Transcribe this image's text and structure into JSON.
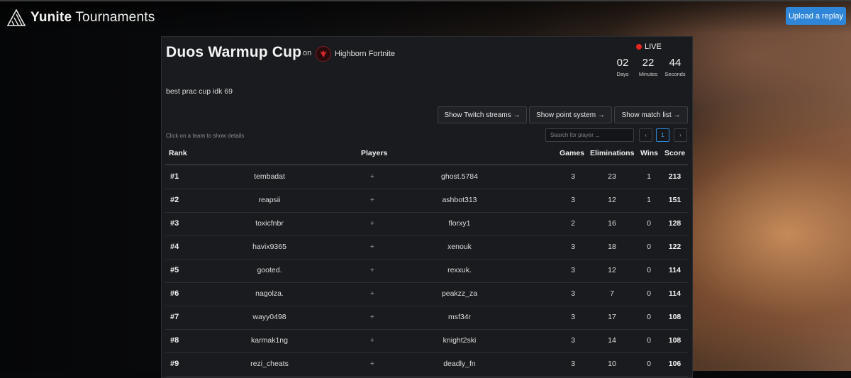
{
  "app": {
    "brand_bold": "Yunite",
    "brand_rest": " Tournaments",
    "upload_label": "Upload a replay"
  },
  "tournament": {
    "title": "Duos Warmup Cup",
    "on_label": "on",
    "org_name": "Highborn Fortnite",
    "description": "best prac cup idk 69",
    "live_label": "LIVE",
    "countdown": [
      {
        "value": "02",
        "label": "Days"
      },
      {
        "value": "22",
        "label": "Minutes"
      },
      {
        "value": "44",
        "label": "Seconds"
      }
    ]
  },
  "actions": [
    {
      "label": "Show Twitch streams →"
    },
    {
      "label": "Show point system →"
    },
    {
      "label": "Show match list →"
    }
  ],
  "hint": "Click on a team to show details",
  "search": {
    "placeholder": "Search for player ..."
  },
  "pagination": {
    "prev": "‹",
    "current": "1",
    "next": "›"
  },
  "table": {
    "headers": {
      "rank": "Rank",
      "players": "Players",
      "games": "Games",
      "eliminations": "Eliminations",
      "wins": "Wins",
      "score": "Score"
    },
    "plus": "+",
    "rows": [
      {
        "rank": "#1",
        "player1": "tembadat",
        "player2": "ghost.5784",
        "games": "3",
        "elims": "23",
        "wins": "1",
        "score": "213"
      },
      {
        "rank": "#2",
        "player1": "reapsii",
        "player2": "ashbot313",
        "games": "3",
        "elims": "12",
        "wins": "1",
        "score": "151"
      },
      {
        "rank": "#3",
        "player1": "toxicfnbr",
        "player2": "florxy1",
        "games": "2",
        "elims": "16",
        "wins": "0",
        "score": "128"
      },
      {
        "rank": "#4",
        "player1": "havix9365",
        "player2": "xenouk",
        "games": "3",
        "elims": "18",
        "wins": "0",
        "score": "122"
      },
      {
        "rank": "#5",
        "player1": "gooted.",
        "player2": "rexxuk.",
        "games": "3",
        "elims": "12",
        "wins": "0",
        "score": "114"
      },
      {
        "rank": "#6",
        "player1": "nagolza.",
        "player2": "peakzz_za",
        "games": "3",
        "elims": "7",
        "wins": "0",
        "score": "114"
      },
      {
        "rank": "#7",
        "player1": "wayy0498",
        "player2": "msf34r",
        "games": "3",
        "elims": "17",
        "wins": "0",
        "score": "108"
      },
      {
        "rank": "#8",
        "player1": "karmak1ng",
        "player2": "knight2ski",
        "games": "3",
        "elims": "14",
        "wins": "0",
        "score": "108"
      },
      {
        "rank": "#9",
        "player1": "rezi_cheats",
        "player2": "deadly_fn",
        "games": "3",
        "elims": "10",
        "wins": "0",
        "score": "106"
      }
    ]
  }
}
